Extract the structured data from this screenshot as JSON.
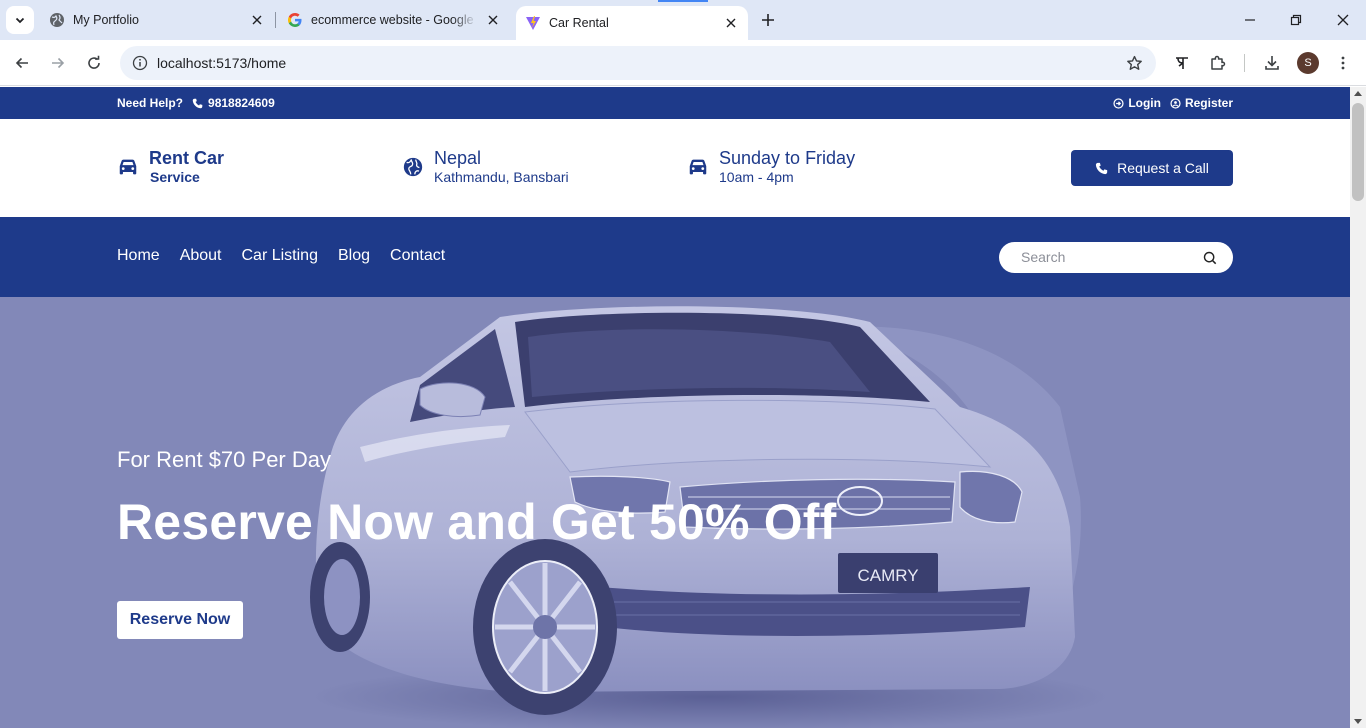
{
  "browser": {
    "tabs": [
      {
        "title": "My Portfolio",
        "favicon": "globe-icon",
        "active": false
      },
      {
        "title": "ecommerce website - Google Se",
        "favicon": "google-icon",
        "active": false
      },
      {
        "title": "Car Rental",
        "favicon": "vite-icon",
        "active": true
      }
    ],
    "url": "localhost:5173/home",
    "profile_initial": "S",
    "colors": {
      "tabbar": "#dfe7f6",
      "omnibox": "#edf2fa",
      "avatar": "#5b3a2e"
    }
  },
  "topbar": {
    "help_label": "Need Help?",
    "phone": "9818824609",
    "login": "Login",
    "register": "Register"
  },
  "infobar": {
    "brand": {
      "title": "Rent Car",
      "subtitle": "Service",
      "icon": "car-icon"
    },
    "location": {
      "title": "Nepal",
      "subtitle": "Kathmandu, Bansbari",
      "icon": "globe-icon"
    },
    "hours": {
      "title": "Sunday to Friday",
      "subtitle": "10am - 4pm",
      "icon": "car-icon"
    },
    "call_button": "Request a Call"
  },
  "nav": {
    "links": [
      "Home",
      "About",
      "Car Listing",
      "Blog",
      "Contact"
    ],
    "search_placeholder": "Search"
  },
  "hero": {
    "subtitle": "For Rent $70 Per Day",
    "title": "Reserve Now and Get 50% Off",
    "button": "Reserve Now",
    "plate": "CAMRY"
  },
  "theme": {
    "primary": "#1e3a8a",
    "hero_overlay": "#8288b8",
    "text_on_primary": "#ffffff"
  }
}
